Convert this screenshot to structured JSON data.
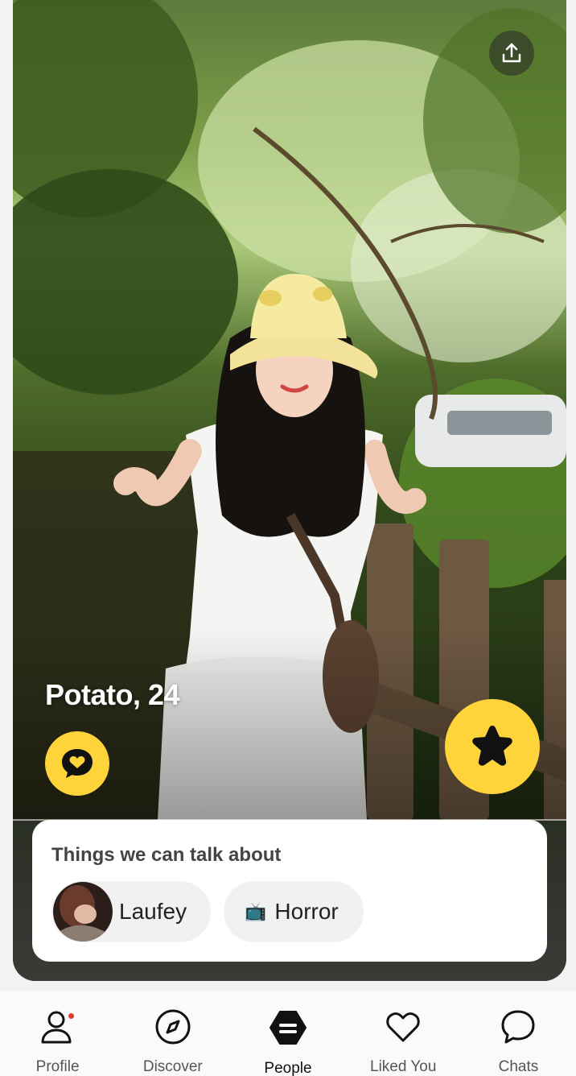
{
  "profile": {
    "name_age": "Potato, 24"
  },
  "talk_about": {
    "title": "Things we can talk about",
    "chips": [
      {
        "label": "Laufey",
        "icon": "artist-avatar"
      },
      {
        "label": "Horror",
        "icon": "tv-emoji",
        "emoji": "📺"
      }
    ]
  },
  "nav": {
    "items": [
      {
        "label": "Profile",
        "icon": "profile-icon",
        "badge": true
      },
      {
        "label": "Discover",
        "icon": "compass-icon"
      },
      {
        "label": "People",
        "icon": "people-icon",
        "active": true
      },
      {
        "label": "Liked You",
        "icon": "heart-icon"
      },
      {
        "label": "Chats",
        "icon": "chat-icon"
      }
    ]
  },
  "colors": {
    "accent": "#ffd43a",
    "badge": "#e23b2e"
  }
}
